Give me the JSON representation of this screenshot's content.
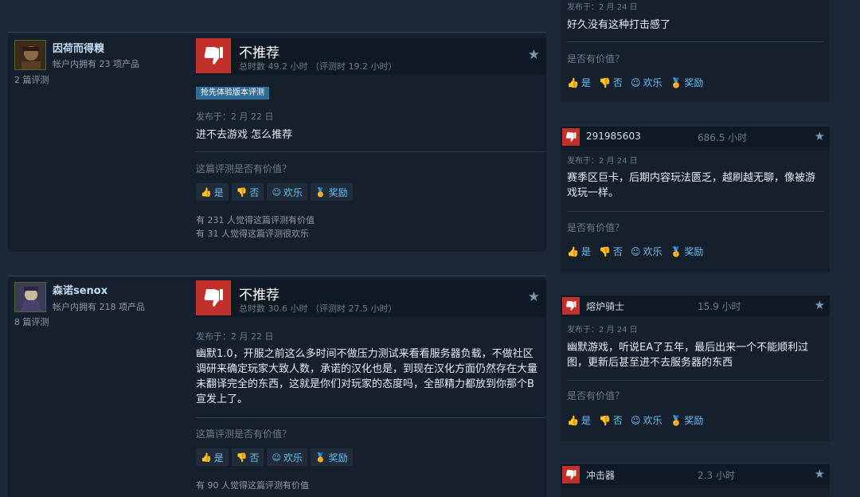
{
  "colors": {
    "background": "#1b2838",
    "panel": "#16202d",
    "thumbs_down": "#c2302a",
    "link": "#66c0f4",
    "award": "#f0b400",
    "badge": "#2f6d98"
  },
  "vote_buttons": {
    "yes": "是",
    "no": "否",
    "funny": "欢乐",
    "award": "奖励"
  },
  "reviews": [
    {
      "persona": "因荷而得糗",
      "owned": "帐户内拥有 23 项产品",
      "review_count": "2 篇评测",
      "vote": "不推荐",
      "hours": "总时数 49.2 小时 （评测时 19.2 小时）",
      "badge": "抢先体验版本评测",
      "posted": "发布于：2 月 22 日",
      "content": "进不去游戏 怎么推荐",
      "helpful_q": "这篇评测是否有价值？",
      "stat1": "有 231 人觉得这篇评测有价值",
      "stat2": "有 31 人觉得这篇评测很欢乐"
    },
    {
      "persona": "森诺senox",
      "owned": "帐户内拥有 218 项产品",
      "review_count": "8 篇评测",
      "vote": "不推荐",
      "hours": "总时数 30.6 小时 （评测时 27.5 小时）",
      "posted": "发布于：2 月 22 日",
      "content": "幽默1.0，开服之前这么多时间不做压力测试来看看服务器负载，不做社区调研来确定玩家大致人数，承诺的汉化也是，到现在汉化方面仍然存在大量未翻译完全的东西，这就是你们对玩家的态度吗，全部精力都放到你那个B宣发上了。",
      "helpful_q": "这篇评测是否有价值？",
      "stat1": "有 90 人觉得这篇评测有价值"
    }
  ],
  "side": [
    {
      "posted": "发布于：2 月 24 日",
      "text": "好久没有这种打击感了",
      "q": "是否有价值？"
    },
    {
      "name": "291985603",
      "hours": "686.5 小时",
      "posted": "发布于：2 月 24 日",
      "text": "赛季区巨卡，后期内容玩法匮乏，越刷越无聊，像被游戏玩一样。",
      "q": "是否有价值？"
    },
    {
      "name": "熔炉骑士",
      "hours": "15.9 小时",
      "posted": "发布于：2 月 24 日",
      "text": "幽默游戏，听说EA了五年，最后出来一个不能顺利过图，更新后甚至进不去服务器的东西",
      "q": "是否有价值？"
    },
    {
      "name": "冲击器",
      "hours": "2.3 小时"
    }
  ]
}
